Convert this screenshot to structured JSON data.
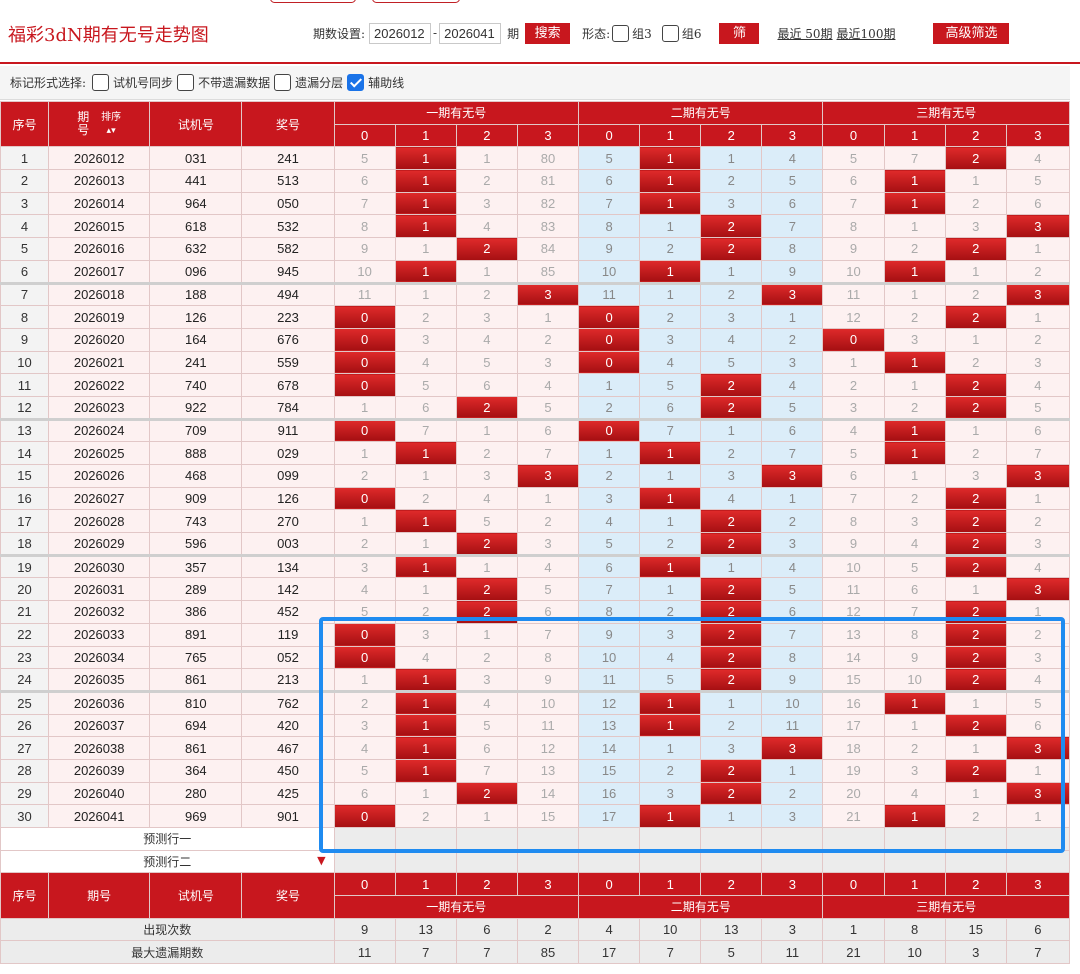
{
  "header": {
    "title": "福彩3dN期有无号走势图",
    "period_label": "期数设置:",
    "period_from": "2026012",
    "period_sep": "-",
    "period_to": "2026041",
    "period_unit": "期",
    "search_label": "搜索",
    "shape_label": "形态:",
    "group3_label": "组3",
    "group6_label": "组6",
    "filter_label": "筛选",
    "recent50_label": "最近 50期",
    "recent100_label": "最近100期",
    "advanced_label": "高级筛选"
  },
  "mark_bar": {
    "label": "标记形式选择:",
    "options": [
      {
        "label": "试机号同步",
        "checked": false
      },
      {
        "label": "不带遗漏数据",
        "checked": false
      },
      {
        "label": "遗漏分层",
        "checked": false
      },
      {
        "label": "辅助线",
        "checked": true
      }
    ]
  },
  "table": {
    "col_seq": "序号",
    "col_period": "期号",
    "col_period_top": "期",
    "col_period_bottom": "号",
    "col_sort": "排序",
    "col_trial": "试机号",
    "col_draw": "奖号",
    "group1": "一期有无号",
    "group2": "二期有无号",
    "group3": "三期有无号",
    "sub_cols": [
      "0",
      "1",
      "2",
      "3"
    ],
    "rows": [
      {
        "seq": "1",
        "period": "2026012",
        "trial": "031",
        "draw": "241",
        "g1": [
          "5",
          "1",
          "1",
          "80"
        ],
        "h1": 1,
        "g2": [
          "5",
          "1",
          "1",
          "4"
        ],
        "h2": 1,
        "g3": [
          "5",
          "7",
          "2",
          "4"
        ],
        "h3": 2
      },
      {
        "seq": "2",
        "period": "2026013",
        "trial": "441",
        "draw": "513",
        "g1": [
          "6",
          "1",
          "2",
          "81"
        ],
        "h1": 1,
        "g2": [
          "6",
          "1",
          "2",
          "5"
        ],
        "h2": 1,
        "g3": [
          "6",
          "1",
          "1",
          "5"
        ],
        "h3": 1
      },
      {
        "seq": "3",
        "period": "2026014",
        "trial": "964",
        "draw": "050",
        "g1": [
          "7",
          "1",
          "3",
          "82"
        ],
        "h1": 1,
        "g2": [
          "7",
          "1",
          "3",
          "6"
        ],
        "h2": 1,
        "g3": [
          "7",
          "1",
          "2",
          "6"
        ],
        "h3": 1
      },
      {
        "seq": "4",
        "period": "2026015",
        "trial": "618",
        "draw": "532",
        "g1": [
          "8",
          "1",
          "4",
          "83"
        ],
        "h1": 1,
        "g2": [
          "8",
          "1",
          "2",
          "7"
        ],
        "h2": 2,
        "g3": [
          "8",
          "1",
          "3",
          "3"
        ],
        "h3": 3
      },
      {
        "seq": "5",
        "period": "2026016",
        "trial": "632",
        "draw": "582",
        "g1": [
          "9",
          "1",
          "2",
          "84"
        ],
        "h1": 2,
        "g2": [
          "9",
          "2",
          "2",
          "8"
        ],
        "h2": 2,
        "g3": [
          "9",
          "2",
          "2",
          "1"
        ],
        "h3": 2
      },
      {
        "seq": "6",
        "period": "2026017",
        "trial": "096",
        "draw": "945",
        "g1": [
          "10",
          "1",
          "1",
          "85"
        ],
        "h1": 1,
        "g2": [
          "10",
          "1",
          "1",
          "9"
        ],
        "h2": 1,
        "g3": [
          "10",
          "1",
          "1",
          "2"
        ],
        "h3": 1
      },
      {
        "seq": "7",
        "period": "2026018",
        "trial": "188",
        "draw": "494",
        "g1": [
          "11",
          "1",
          "2",
          "3"
        ],
        "h1": 3,
        "g2": [
          "11",
          "1",
          "2",
          "3"
        ],
        "h2": 3,
        "g3": [
          "11",
          "1",
          "2",
          "3"
        ],
        "h3": 3
      },
      {
        "seq": "8",
        "period": "2026019",
        "trial": "126",
        "draw": "223",
        "g1": [
          "0",
          "2",
          "3",
          "1"
        ],
        "h1": 0,
        "g2": [
          "0",
          "2",
          "3",
          "1"
        ],
        "h2": 0,
        "g3": [
          "12",
          "2",
          "2",
          "1"
        ],
        "h3": 2
      },
      {
        "seq": "9",
        "period": "2026020",
        "trial": "164",
        "draw": "676",
        "g1": [
          "0",
          "3",
          "4",
          "2"
        ],
        "h1": 0,
        "g2": [
          "0",
          "3",
          "4",
          "2"
        ],
        "h2": 0,
        "g3": [
          "0",
          "3",
          "1",
          "2"
        ],
        "h3": 0
      },
      {
        "seq": "10",
        "period": "2026021",
        "trial": "241",
        "draw": "559",
        "g1": [
          "0",
          "4",
          "5",
          "3"
        ],
        "h1": 0,
        "g2": [
          "0",
          "4",
          "5",
          "3"
        ],
        "h2": 0,
        "g3": [
          "1",
          "1",
          "2",
          "3"
        ],
        "h3": 1
      },
      {
        "seq": "11",
        "period": "2026022",
        "trial": "740",
        "draw": "678",
        "g1": [
          "0",
          "5",
          "6",
          "4"
        ],
        "h1": 0,
        "g2": [
          "1",
          "5",
          "2",
          "4"
        ],
        "h2": 2,
        "g3": [
          "2",
          "1",
          "2",
          "4"
        ],
        "h3": 2
      },
      {
        "seq": "12",
        "period": "2026023",
        "trial": "922",
        "draw": "784",
        "g1": [
          "1",
          "6",
          "2",
          "5"
        ],
        "h1": 2,
        "g2": [
          "2",
          "6",
          "2",
          "5"
        ],
        "h2": 2,
        "g3": [
          "3",
          "2",
          "2",
          "5"
        ],
        "h3": 2
      },
      {
        "seq": "13",
        "period": "2026024",
        "trial": "709",
        "draw": "911",
        "g1": [
          "0",
          "7",
          "1",
          "6"
        ],
        "h1": 0,
        "g2": [
          "0",
          "7",
          "1",
          "6"
        ],
        "h2": 0,
        "g3": [
          "4",
          "1",
          "1",
          "6"
        ],
        "h3": 1
      },
      {
        "seq": "14",
        "period": "2026025",
        "trial": "888",
        "draw": "029",
        "g1": [
          "1",
          "1",
          "2",
          "7"
        ],
        "h1": 1,
        "g2": [
          "1",
          "1",
          "2",
          "7"
        ],
        "h2": 1,
        "g3": [
          "5",
          "1",
          "2",
          "7"
        ],
        "h3": 1
      },
      {
        "seq": "15",
        "period": "2026026",
        "trial": "468",
        "draw": "099",
        "g1": [
          "2",
          "1",
          "3",
          "3"
        ],
        "h1": 3,
        "g2": [
          "2",
          "1",
          "3",
          "3"
        ],
        "h2": 3,
        "g3": [
          "6",
          "1",
          "3",
          "3"
        ],
        "h3": 3
      },
      {
        "seq": "16",
        "period": "2026027",
        "trial": "909",
        "draw": "126",
        "g1": [
          "0",
          "2",
          "4",
          "1"
        ],
        "h1": 0,
        "g2": [
          "3",
          "1",
          "4",
          "1"
        ],
        "h2": 1,
        "g3": [
          "7",
          "2",
          "2",
          "1"
        ],
        "h3": 2
      },
      {
        "seq": "17",
        "period": "2026028",
        "trial": "743",
        "draw": "270",
        "g1": [
          "1",
          "1",
          "5",
          "2"
        ],
        "h1": 1,
        "g2": [
          "4",
          "1",
          "2",
          "2"
        ],
        "h2": 2,
        "g3": [
          "8",
          "3",
          "2",
          "2"
        ],
        "h3": 2
      },
      {
        "seq": "18",
        "period": "2026029",
        "trial": "596",
        "draw": "003",
        "g1": [
          "2",
          "1",
          "2",
          "3"
        ],
        "h1": 2,
        "g2": [
          "5",
          "2",
          "2",
          "3"
        ],
        "h2": 2,
        "g3": [
          "9",
          "4",
          "2",
          "3"
        ],
        "h3": 2
      },
      {
        "seq": "19",
        "period": "2026030",
        "trial": "357",
        "draw": "134",
        "g1": [
          "3",
          "1",
          "1",
          "4"
        ],
        "h1": 1,
        "g2": [
          "6",
          "1",
          "1",
          "4"
        ],
        "h2": 1,
        "g3": [
          "10",
          "5",
          "2",
          "4"
        ],
        "h3": 2
      },
      {
        "seq": "20",
        "period": "2026031",
        "trial": "289",
        "draw": "142",
        "g1": [
          "4",
          "1",
          "2",
          "5"
        ],
        "h1": 2,
        "g2": [
          "7",
          "1",
          "2",
          "5"
        ],
        "h2": 2,
        "g3": [
          "11",
          "6",
          "1",
          "3"
        ],
        "h3": 3
      },
      {
        "seq": "21",
        "period": "2026032",
        "trial": "386",
        "draw": "452",
        "g1": [
          "5",
          "2",
          "2",
          "6"
        ],
        "h1": 2,
        "g2": [
          "8",
          "2",
          "2",
          "6"
        ],
        "h2": 2,
        "g3": [
          "12",
          "7",
          "2",
          "1"
        ],
        "h3": 2
      },
      {
        "seq": "22",
        "period": "2026033",
        "trial": "891",
        "draw": "119",
        "g1": [
          "0",
          "3",
          "1",
          "7"
        ],
        "h1": 0,
        "g2": [
          "9",
          "3",
          "2",
          "7"
        ],
        "h2": 2,
        "g3": [
          "13",
          "8",
          "2",
          "2"
        ],
        "h3": 2
      },
      {
        "seq": "23",
        "period": "2026034",
        "trial": "765",
        "draw": "052",
        "g1": [
          "0",
          "4",
          "2",
          "8"
        ],
        "h1": 0,
        "g2": [
          "10",
          "4",
          "2",
          "8"
        ],
        "h2": 2,
        "g3": [
          "14",
          "9",
          "2",
          "3"
        ],
        "h3": 2
      },
      {
        "seq": "24",
        "period": "2026035",
        "trial": "861",
        "draw": "213",
        "g1": [
          "1",
          "1",
          "3",
          "9"
        ],
        "h1": 1,
        "g2": [
          "11",
          "5",
          "2",
          "9"
        ],
        "h2": 2,
        "g3": [
          "15",
          "10",
          "2",
          "4"
        ],
        "h3": 2
      },
      {
        "seq": "25",
        "period": "2026036",
        "trial": "810",
        "draw": "762",
        "g1": [
          "2",
          "1",
          "4",
          "10"
        ],
        "h1": 1,
        "g2": [
          "12",
          "1",
          "1",
          "10"
        ],
        "h2": 1,
        "g3": [
          "16",
          "1",
          "1",
          "5"
        ],
        "h3": 1
      },
      {
        "seq": "26",
        "period": "2026037",
        "trial": "694",
        "draw": "420",
        "g1": [
          "3",
          "1",
          "5",
          "11"
        ],
        "h1": 1,
        "g2": [
          "13",
          "1",
          "2",
          "11"
        ],
        "h2": 1,
        "g3": [
          "17",
          "1",
          "2",
          "6"
        ],
        "h3": 2
      },
      {
        "seq": "27",
        "period": "2026038",
        "trial": "861",
        "draw": "467",
        "g1": [
          "4",
          "1",
          "6",
          "12"
        ],
        "h1": 1,
        "g2": [
          "14",
          "1",
          "3",
          "3"
        ],
        "h2": 3,
        "g3": [
          "18",
          "2",
          "1",
          "3"
        ],
        "h3": 3
      },
      {
        "seq": "28",
        "period": "2026039",
        "trial": "364",
        "draw": "450",
        "g1": [
          "5",
          "1",
          "7",
          "13"
        ],
        "h1": 1,
        "g2": [
          "15",
          "2",
          "2",
          "1"
        ],
        "h2": 2,
        "g3": [
          "19",
          "3",
          "2",
          "1"
        ],
        "h3": 2
      },
      {
        "seq": "29",
        "period": "2026040",
        "trial": "280",
        "draw": "425",
        "g1": [
          "6",
          "1",
          "2",
          "14"
        ],
        "h1": 2,
        "g2": [
          "16",
          "3",
          "2",
          "2"
        ],
        "h2": 2,
        "g3": [
          "20",
          "4",
          "1",
          "3"
        ],
        "h3": 3
      },
      {
        "seq": "30",
        "period": "2026041",
        "trial": "969",
        "draw": "901",
        "g1": [
          "0",
          "2",
          "1",
          "15"
        ],
        "h1": 0,
        "g2": [
          "17",
          "1",
          "1",
          "3"
        ],
        "h2": 1,
        "g3": [
          "21",
          "1",
          "2",
          "1"
        ],
        "h3": 1
      }
    ],
    "predict_row1": "预测行一",
    "predict_row2": "预测行二",
    "footer_sub": [
      "0",
      "1",
      "2",
      "3",
      "0",
      "1",
      "2",
      "3",
      "0",
      "1",
      "2",
      "3"
    ],
    "footer_seq": "序号",
    "footer_period": "期号",
    "footer_trial": "试机号",
    "footer_draw": "奖号",
    "stats": [
      {
        "label": "出现次数",
        "values": [
          "9",
          "13",
          "6",
          "2",
          "4",
          "10",
          "13",
          "3",
          "1",
          "8",
          "15",
          "6"
        ]
      },
      {
        "label": "最大遗漏期数",
        "values": [
          "11",
          "7",
          "7",
          "85",
          "17",
          "7",
          "5",
          "11",
          "21",
          "10",
          "3",
          "7"
        ]
      }
    ]
  },
  "colors": {
    "accent": "#c8171e",
    "highlight_box": "#1f8bf0",
    "group2_bg": "#dbedf9",
    "cell_bg": "#fdf1f1"
  }
}
